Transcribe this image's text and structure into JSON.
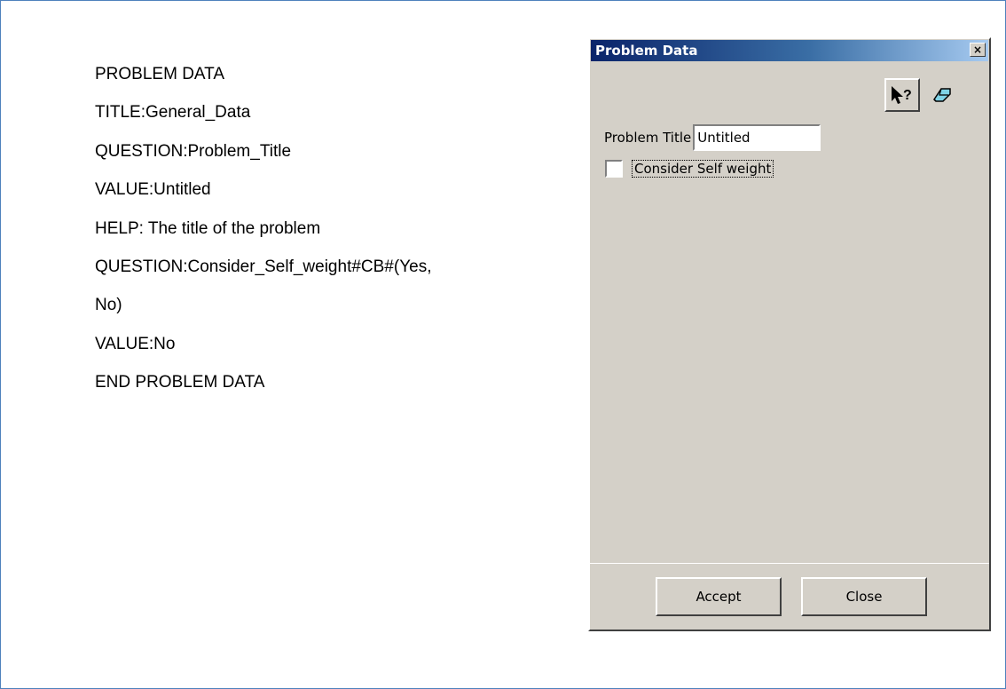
{
  "document": {
    "lines": [
      "PROBLEM DATA",
      "TITLE:General_Data",
      "QUESTION:Problem_Title",
      "VALUE:Untitled",
      "HELP: The title of the problem",
      "QUESTION:Consider_Self_weight#CB#(Yes,",
      "No)",
      "VALUE:No",
      "END PROBLEM DATA"
    ]
  },
  "dialog": {
    "title": "Problem Data",
    "close_glyph": "×",
    "toolbar": {
      "help_icon": "help-pointer-icon",
      "eraser_icon": "eraser-icon"
    },
    "problem_title_label": "Problem Title",
    "problem_title_value": "Untitled",
    "self_weight_label": "Consider Self weight",
    "self_weight_checked": false,
    "accept_label": "Accept",
    "close_label": "Close"
  },
  "colors": {
    "dialog_bg": "#d4d0c8",
    "titlebar_start": "#0a246a",
    "titlebar_end": "#a6caf0",
    "frame_border": "#4f81bd"
  }
}
